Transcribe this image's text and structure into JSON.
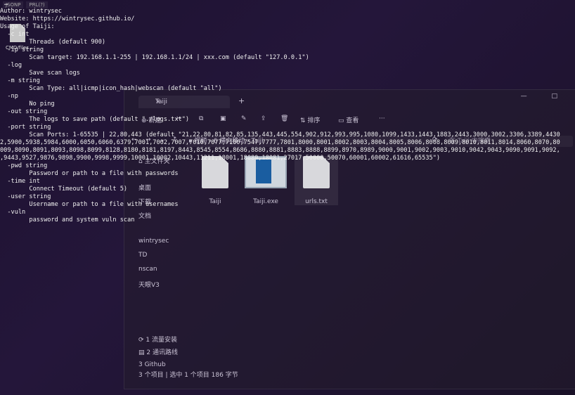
{
  "desktop": {
    "topbar_tabs": [
      "JSONP",
      "PRL(?)"
    ],
    "icon_label": "CMD/files..."
  },
  "explorer": {
    "tab_title": "Taiji",
    "tab_close": "×",
    "new_tab": "+",
    "window_controls": "— □",
    "toolbar": {
      "new": "⊕ 新建",
      "cut": "✂",
      "copy": "⧉",
      "paste": "▣",
      "rename": "✎",
      "share": "⇪",
      "delete": "🗑",
      "sort": "⇅ 排序",
      "view": "▭ 查看",
      "more": "···"
    },
    "nav_buttons": [
      "←",
      "→",
      "⌄",
      "↑"
    ],
    "breadcrumb": "▸ 视频 › 6 横向移动 › Taiji",
    "refresh": "⟳",
    "search_placeholder": "在 Taiji 中搜索",
    "sidebar": [
      "⌂ 主文件夹",
      "桌面",
      "下载",
      "文档",
      "wintrysec",
      "TD",
      "nscan",
      "天眼V3",
      "⟳ 1 流量安装",
      "▤ 2 通讯路线",
      "3 Github"
    ],
    "files": [
      {
        "name": "Taiji",
        "kind": "doc"
      },
      {
        "name": "Taiji.exe",
        "kind": "exe"
      },
      {
        "name": "urls.txt",
        "kind": "doc"
      }
    ],
    "status": "3 个项目  |  选中 1 个项目  186 字节"
  },
  "terminal": {
    "ascii_art": "…",
    "lines": [
      "Author: wintrysec",
      "Website: https://wintrysec.github.io/",
      "Usage of Taiji:",
      "  -c int",
      "        Threads (default 900)",
      "  -ip string",
      "        Scan target: 192.168.1.1-255 | 192.168.1.1/24 | xxx.com (default \"127.0.0.1\")",
      "  -log",
      "        Save scan logs",
      "  -m string",
      "        Scan Type: all|icmp|icon_hash|webscan (default \"all\")",
      "  -np",
      "        No ping",
      "  -out string",
      "        The logs to save path (default \"./logs.txt\")",
      "  -port string",
      "        Scan Ports: 1-65535 | 22,80,443 (default \"21,22,80,81,82,85,135,443,445,554,902,912,993,995,1080,1099,1433,1443,1883,2443,3000,3002,3306,3389,4430",
      "2,5900,5938,5984,6000,6050,6060,6379,7001,7002,7007,7010,7077,7100,7547,7777,7801,8000,8001,8002,8003,8004,8005,8006,8008,8009,8010,8011,8014,8060,8070,80",
      "009,8090,8091,8093,8098,8099,8128,8180,8181,8197,8443,8545,8554,8686,8880,8881,8883,8888,8899,8970,8989,9000,9001,9002,9003,9010,9042,9043,9090,9091,9092,",
      ",9443,9527,9876,9898,9900,9998,9999,10001,10002,10443,11211,18001,18080,18081,27017,50000,50070,60001,60002,61616,65535\")",
      "  -pwd string",
      "        Password or path to a file with passwords",
      "  -time int",
      "        Connect Timeout (default 5)",
      "  -user string",
      "        Username or path to a file with usernames",
      "  -vuln",
      "        password and system vuln scan"
    ]
  }
}
